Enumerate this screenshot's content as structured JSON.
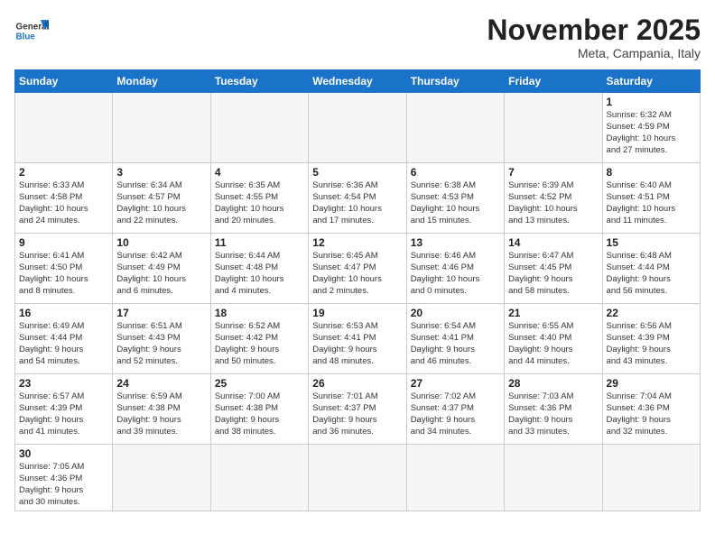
{
  "header": {
    "logo_general": "General",
    "logo_blue": "Blue",
    "month_title": "November 2025",
    "subtitle": "Meta, Campania, Italy"
  },
  "days_of_week": [
    "Sunday",
    "Monday",
    "Tuesday",
    "Wednesday",
    "Thursday",
    "Friday",
    "Saturday"
  ],
  "weeks": [
    [
      {
        "day": null,
        "info": null
      },
      {
        "day": null,
        "info": null
      },
      {
        "day": null,
        "info": null
      },
      {
        "day": null,
        "info": null
      },
      {
        "day": null,
        "info": null
      },
      {
        "day": null,
        "info": null
      },
      {
        "day": "1",
        "info": "Sunrise: 6:32 AM\nSunset: 4:59 PM\nDaylight: 10 hours\nand 27 minutes."
      }
    ],
    [
      {
        "day": "2",
        "info": "Sunrise: 6:33 AM\nSunset: 4:58 PM\nDaylight: 10 hours\nand 24 minutes."
      },
      {
        "day": "3",
        "info": "Sunrise: 6:34 AM\nSunset: 4:57 PM\nDaylight: 10 hours\nand 22 minutes."
      },
      {
        "day": "4",
        "info": "Sunrise: 6:35 AM\nSunset: 4:55 PM\nDaylight: 10 hours\nand 20 minutes."
      },
      {
        "day": "5",
        "info": "Sunrise: 6:36 AM\nSunset: 4:54 PM\nDaylight: 10 hours\nand 17 minutes."
      },
      {
        "day": "6",
        "info": "Sunrise: 6:38 AM\nSunset: 4:53 PM\nDaylight: 10 hours\nand 15 minutes."
      },
      {
        "day": "7",
        "info": "Sunrise: 6:39 AM\nSunset: 4:52 PM\nDaylight: 10 hours\nand 13 minutes."
      },
      {
        "day": "8",
        "info": "Sunrise: 6:40 AM\nSunset: 4:51 PM\nDaylight: 10 hours\nand 11 minutes."
      }
    ],
    [
      {
        "day": "9",
        "info": "Sunrise: 6:41 AM\nSunset: 4:50 PM\nDaylight: 10 hours\nand 8 minutes."
      },
      {
        "day": "10",
        "info": "Sunrise: 6:42 AM\nSunset: 4:49 PM\nDaylight: 10 hours\nand 6 minutes."
      },
      {
        "day": "11",
        "info": "Sunrise: 6:44 AM\nSunset: 4:48 PM\nDaylight: 10 hours\nand 4 minutes."
      },
      {
        "day": "12",
        "info": "Sunrise: 6:45 AM\nSunset: 4:47 PM\nDaylight: 10 hours\nand 2 minutes."
      },
      {
        "day": "13",
        "info": "Sunrise: 6:46 AM\nSunset: 4:46 PM\nDaylight: 10 hours\nand 0 minutes."
      },
      {
        "day": "14",
        "info": "Sunrise: 6:47 AM\nSunset: 4:45 PM\nDaylight: 9 hours\nand 58 minutes."
      },
      {
        "day": "15",
        "info": "Sunrise: 6:48 AM\nSunset: 4:44 PM\nDaylight: 9 hours\nand 56 minutes."
      }
    ],
    [
      {
        "day": "16",
        "info": "Sunrise: 6:49 AM\nSunset: 4:44 PM\nDaylight: 9 hours\nand 54 minutes."
      },
      {
        "day": "17",
        "info": "Sunrise: 6:51 AM\nSunset: 4:43 PM\nDaylight: 9 hours\nand 52 minutes."
      },
      {
        "day": "18",
        "info": "Sunrise: 6:52 AM\nSunset: 4:42 PM\nDaylight: 9 hours\nand 50 minutes."
      },
      {
        "day": "19",
        "info": "Sunrise: 6:53 AM\nSunset: 4:41 PM\nDaylight: 9 hours\nand 48 minutes."
      },
      {
        "day": "20",
        "info": "Sunrise: 6:54 AM\nSunset: 4:41 PM\nDaylight: 9 hours\nand 46 minutes."
      },
      {
        "day": "21",
        "info": "Sunrise: 6:55 AM\nSunset: 4:40 PM\nDaylight: 9 hours\nand 44 minutes."
      },
      {
        "day": "22",
        "info": "Sunrise: 6:56 AM\nSunset: 4:39 PM\nDaylight: 9 hours\nand 43 minutes."
      }
    ],
    [
      {
        "day": "23",
        "info": "Sunrise: 6:57 AM\nSunset: 4:39 PM\nDaylight: 9 hours\nand 41 minutes."
      },
      {
        "day": "24",
        "info": "Sunrise: 6:59 AM\nSunset: 4:38 PM\nDaylight: 9 hours\nand 39 minutes."
      },
      {
        "day": "25",
        "info": "Sunrise: 7:00 AM\nSunset: 4:38 PM\nDaylight: 9 hours\nand 38 minutes."
      },
      {
        "day": "26",
        "info": "Sunrise: 7:01 AM\nSunset: 4:37 PM\nDaylight: 9 hours\nand 36 minutes."
      },
      {
        "day": "27",
        "info": "Sunrise: 7:02 AM\nSunset: 4:37 PM\nDaylight: 9 hours\nand 34 minutes."
      },
      {
        "day": "28",
        "info": "Sunrise: 7:03 AM\nSunset: 4:36 PM\nDaylight: 9 hours\nand 33 minutes."
      },
      {
        "day": "29",
        "info": "Sunrise: 7:04 AM\nSunset: 4:36 PM\nDaylight: 9 hours\nand 32 minutes."
      }
    ],
    [
      {
        "day": "30",
        "info": "Sunrise: 7:05 AM\nSunset: 4:36 PM\nDaylight: 9 hours\nand 30 minutes."
      },
      {
        "day": null,
        "info": null
      },
      {
        "day": null,
        "info": null
      },
      {
        "day": null,
        "info": null
      },
      {
        "day": null,
        "info": null
      },
      {
        "day": null,
        "info": null
      },
      {
        "day": null,
        "info": null
      }
    ]
  ]
}
